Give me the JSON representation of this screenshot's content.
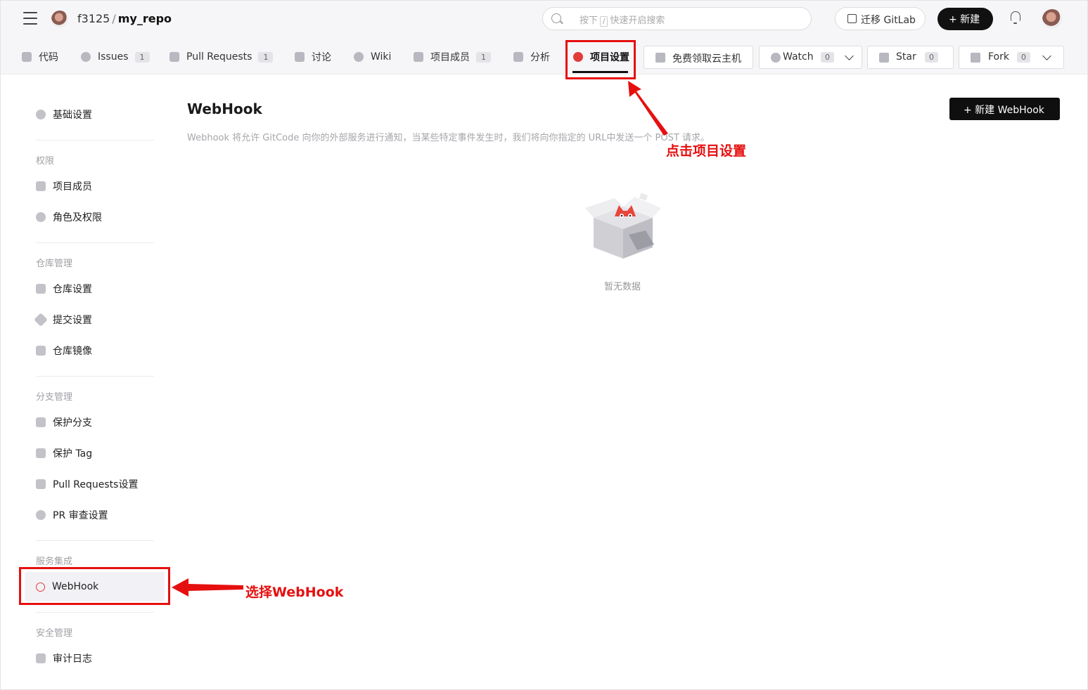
{
  "header": {
    "repo_owner": "f3125",
    "repo_sep": "/",
    "repo_name": "my_repo",
    "search_prefix": "按下",
    "search_key": "/",
    "search_suffix": "快速开启搜索",
    "migrate_label": "迁移 GitLab",
    "new_label": "+ 新建"
  },
  "nav": {
    "tabs": [
      {
        "label": "代码",
        "count": null
      },
      {
        "label": "Issues",
        "count": "1"
      },
      {
        "label": "Pull Requests",
        "count": "1"
      },
      {
        "label": "讨论",
        "count": null
      },
      {
        "label": "Wiki",
        "count": null
      },
      {
        "label": "项目成员",
        "count": "1"
      },
      {
        "label": "分析",
        "count": null
      },
      {
        "label": "项目设置",
        "count": null
      }
    ],
    "cloud_label": "免费领取云主机",
    "watch_label": "Watch",
    "watch_count": "0",
    "star_label": "Star",
    "star_count": "0",
    "fork_label": "Fork",
    "fork_count": "0"
  },
  "sidebar": {
    "basic": "基础设置",
    "group_permissions": "权限",
    "members": "项目成员",
    "roles": "角色及权限",
    "group_repo": "仓库管理",
    "repo_settings": "仓库设置",
    "commit_settings": "提交设置",
    "repo_mirror": "仓库镜像",
    "group_branch": "分支管理",
    "protect_branch": "保护分支",
    "protect_tag": "保护 Tag",
    "pr_settings": "Pull Requests设置",
    "pr_review": "PR 审查设置",
    "group_services": "服务集成",
    "webhook": "WebHook",
    "group_security": "安全管理",
    "audit_log": "审计日志"
  },
  "main": {
    "title": "WebHook",
    "description": "Webhook 将允许 GitCode 向你的外部服务进行通知，当某些特定事件发生时，我们将向你指定的 URL中发送一个 POST 请求。",
    "new_button": "+ 新建 WebHook",
    "empty_text": "暂无数据"
  },
  "annotations": {
    "click_settings": "点击项目设置",
    "select_webhook": "选择WebHook",
    "color": "#e60f0f"
  }
}
